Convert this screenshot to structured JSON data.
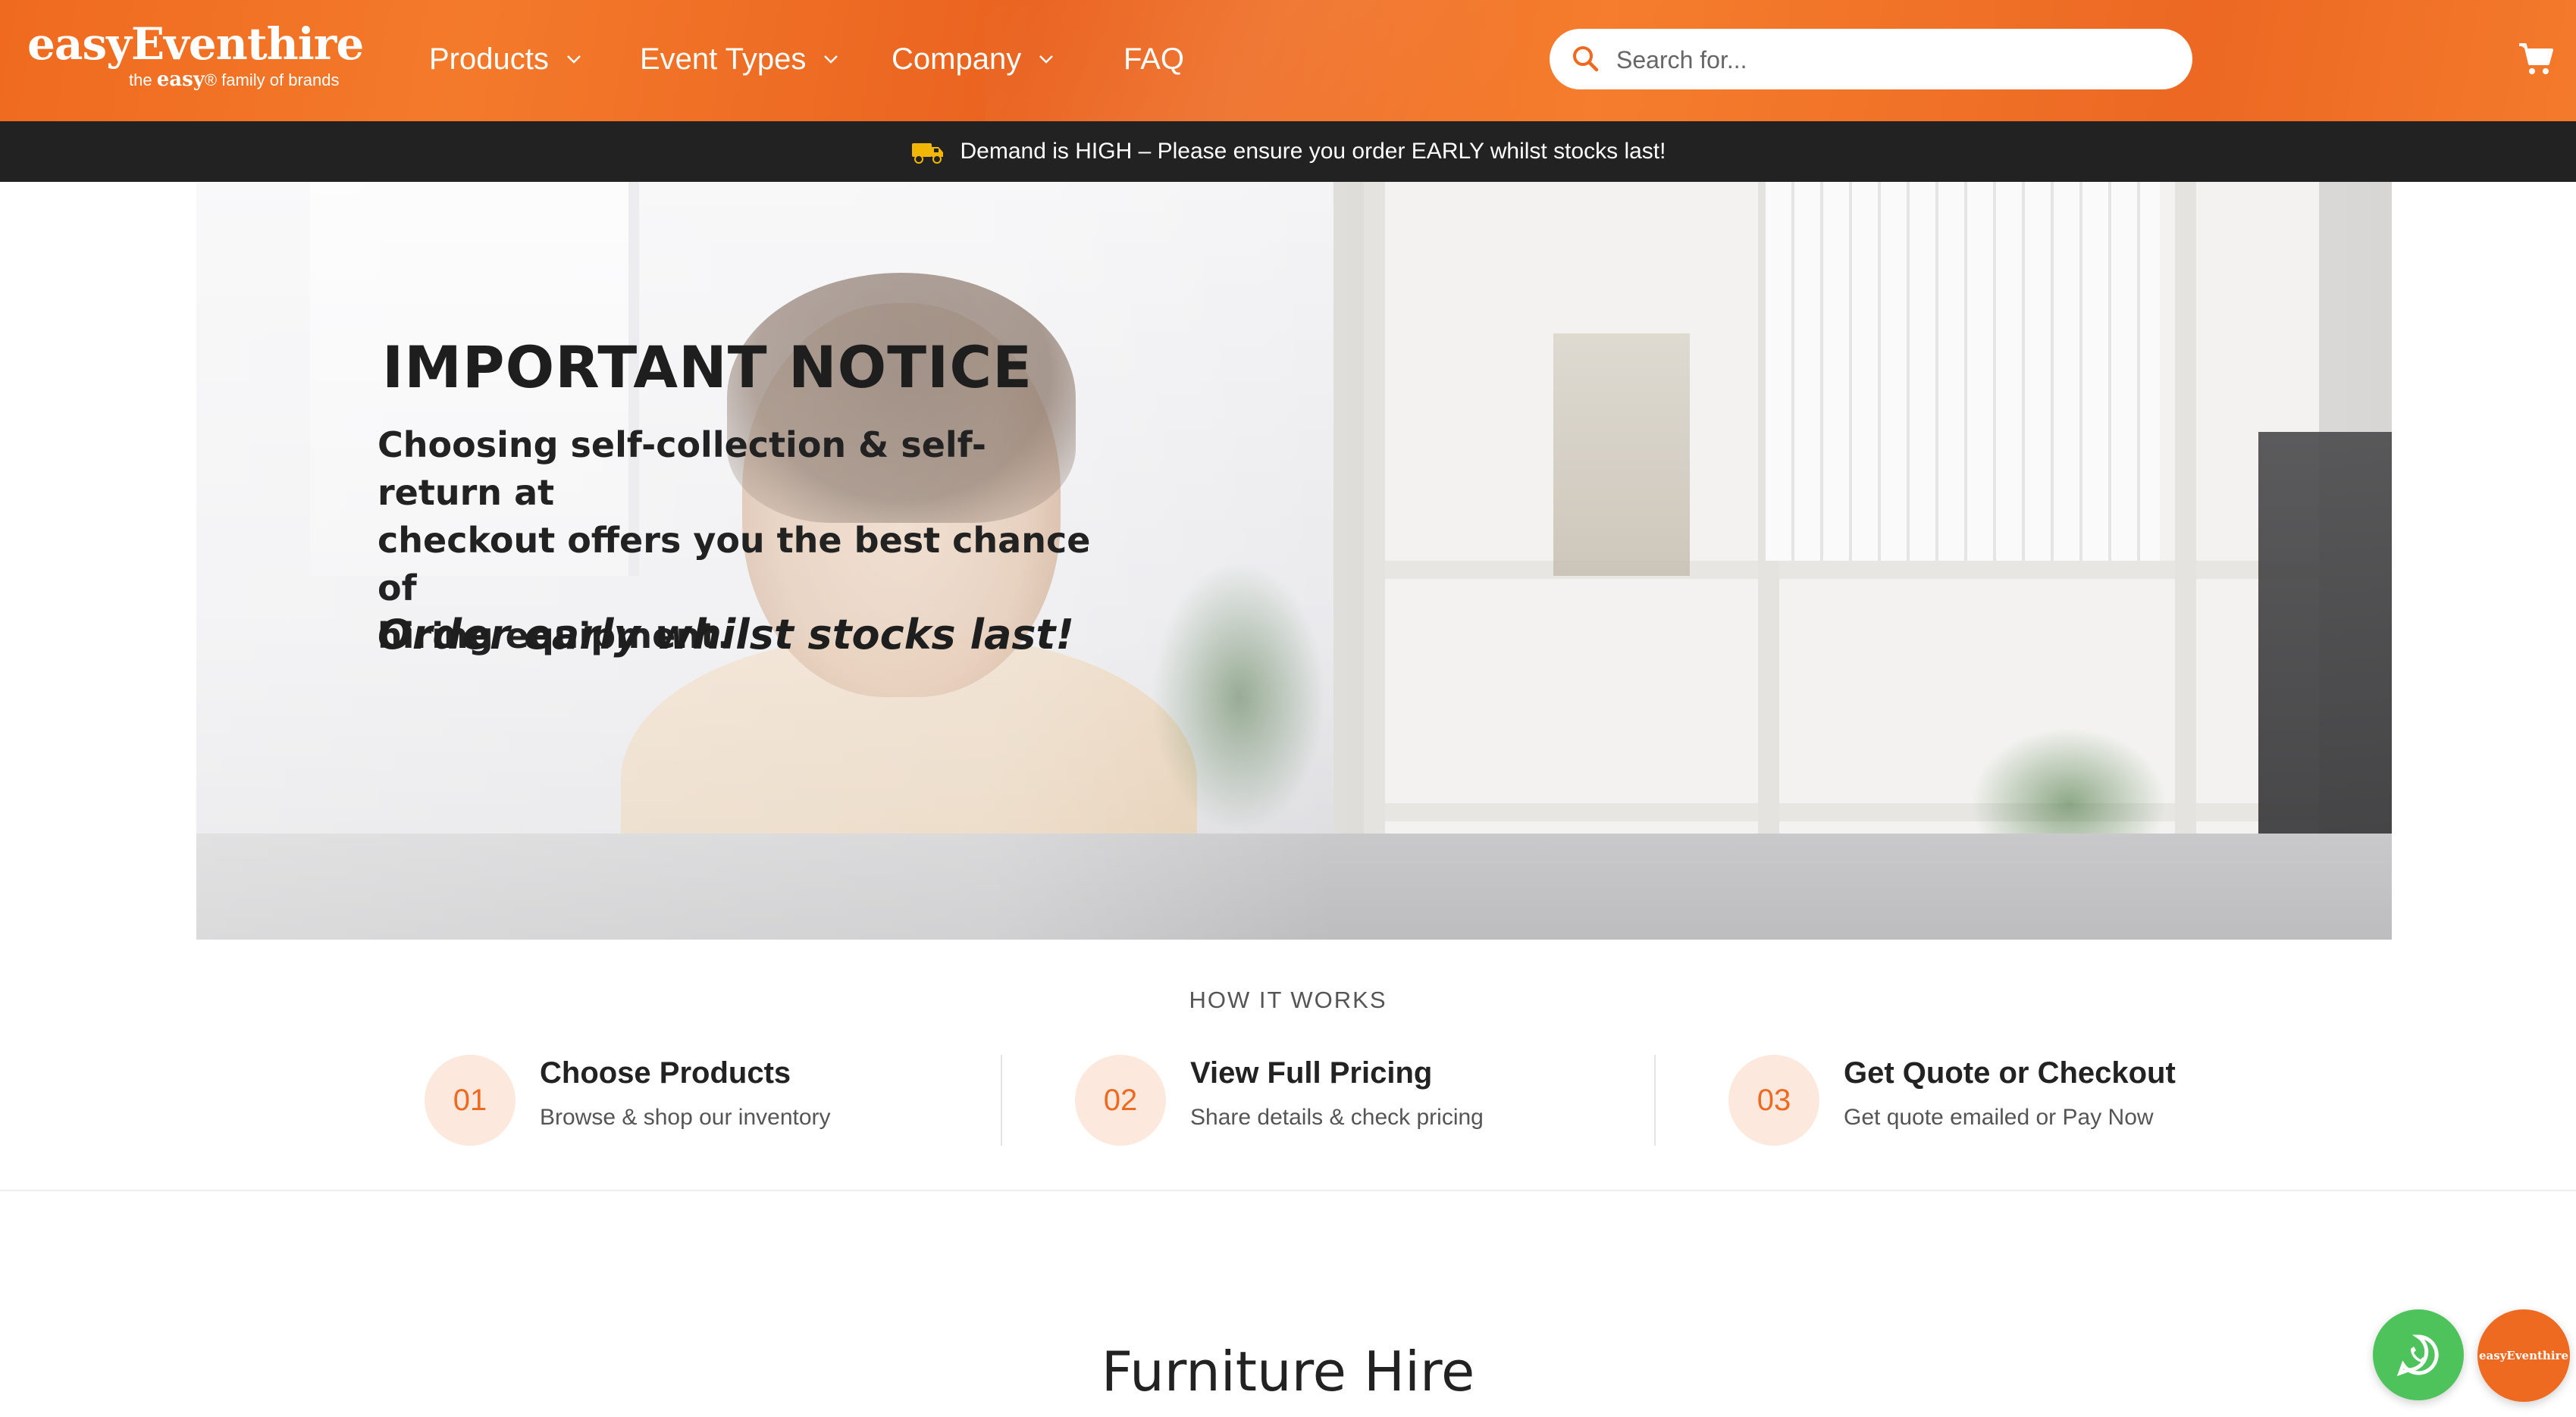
{
  "brand": {
    "name": "easyEventhire",
    "tagline_pre": "the",
    "tagline_brand": "easy",
    "tagline_post": "® family of brands",
    "accent": "#ef6a21"
  },
  "nav": {
    "items": [
      {
        "label": "Products",
        "has_dropdown": true
      },
      {
        "label": "Event Types",
        "has_dropdown": true
      },
      {
        "label": "Company",
        "has_dropdown": true
      },
      {
        "label": "FAQ",
        "has_dropdown": false
      }
    ]
  },
  "search": {
    "placeholder": "Search for...",
    "value": "",
    "icon": "search-icon"
  },
  "cart": {
    "icon": "cart-icon"
  },
  "announcement": {
    "icon": "delivery-truck-icon",
    "text": "Demand is HIGH – Please ensure you order EARLY whilst stocks last!"
  },
  "hero": {
    "title": "IMPORTANT NOTICE",
    "line1": "Choosing self-collection & self-return at",
    "line2": "checkout offers you the best chance of",
    "line3": "hiring equipment.",
    "emphasis": "Order early whilst stocks last!"
  },
  "how_it_works": {
    "title": "HOW IT WORKS",
    "steps": [
      {
        "number": "01",
        "title": "Choose Products",
        "subtitle": "Browse & shop our inventory"
      },
      {
        "number": "02",
        "title": "View Full Pricing",
        "subtitle": "Share details & check pricing"
      },
      {
        "number": "03",
        "title": "Get Quote or Checkout",
        "subtitle": "Get quote emailed or Pay Now"
      }
    ]
  },
  "section": {
    "title": "Furniture Hire"
  },
  "floating": {
    "whatsapp_icon": "whatsapp-icon",
    "brand_badge": "easyEventhire"
  }
}
